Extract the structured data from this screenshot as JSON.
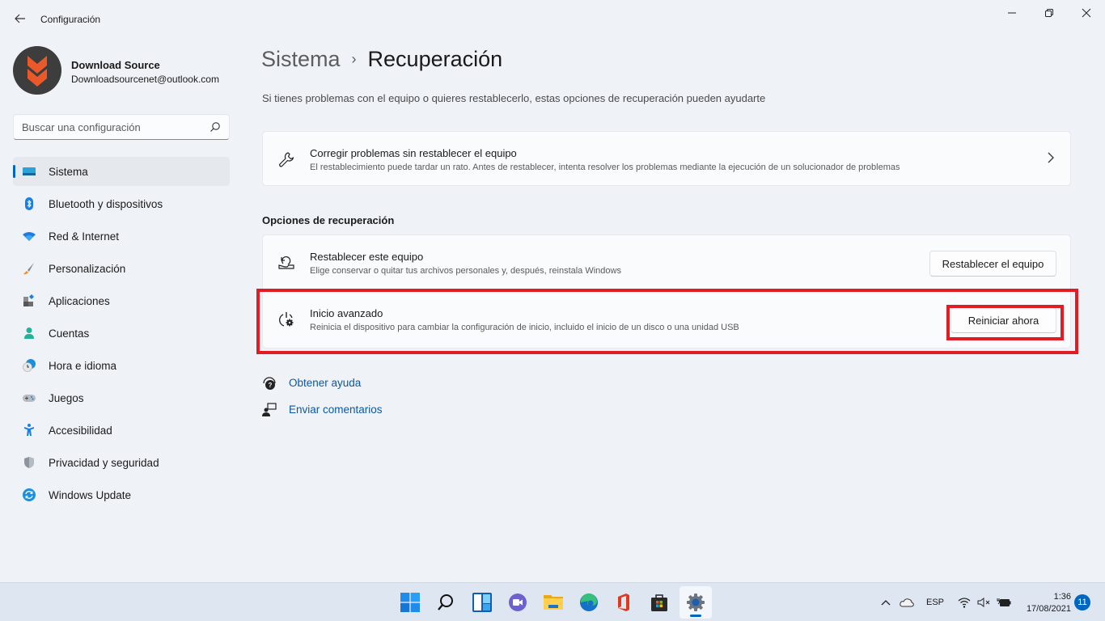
{
  "window": {
    "app_title": "Configuración",
    "back_icon": "arrow-left-icon",
    "controls": [
      "minimize",
      "maximize",
      "close"
    ]
  },
  "profile": {
    "name": "Download Source",
    "email": "Downloadsourcenet@outlook.com"
  },
  "search": {
    "placeholder": "Buscar una configuración",
    "value": ""
  },
  "sidebar": {
    "items": [
      {
        "label": "Sistema",
        "icon": "system-icon",
        "active": true
      },
      {
        "label": "Bluetooth y dispositivos",
        "icon": "bluetooth-icon"
      },
      {
        "label": "Red & Internet",
        "icon": "wifi-icon"
      },
      {
        "label": "Personalización",
        "icon": "brush-icon"
      },
      {
        "label": "Aplicaciones",
        "icon": "apps-icon"
      },
      {
        "label": "Cuentas",
        "icon": "account-icon"
      },
      {
        "label": "Hora e idioma",
        "icon": "time-language-icon"
      },
      {
        "label": "Juegos",
        "icon": "gamepad-icon"
      },
      {
        "label": "Accesibilidad",
        "icon": "accessibility-icon"
      },
      {
        "label": "Privacidad y seguridad",
        "icon": "shield-icon"
      },
      {
        "label": "Windows Update",
        "icon": "windows-update-icon"
      }
    ]
  },
  "main": {
    "breadcrumb": {
      "parent": "Sistema",
      "separator": "›",
      "current": "Recuperación"
    },
    "subtitle": "Si tienes problemas con el equipo o quieres restablecerlo, estas opciones de recuperación pueden ayudarte",
    "fix_card": {
      "title": "Corregir problemas sin restablecer el equipo",
      "description": "El restablecimiento puede tardar un rato. Antes de restablecer, intenta resolver los problemas mediante la ejecución de un solucionador de problemas"
    },
    "section_heading": "Opciones de recuperación",
    "options": [
      {
        "title": "Restablecer este equipo",
        "description": "Elige conservar o quitar tus archivos personales y, después, reinstala Windows",
        "button": "Restablecer el equipo"
      },
      {
        "title": "Inicio avanzado",
        "description": "Reinicia el dispositivo para cambiar la configuración de inicio, incluido el inicio de un disco o una unidad USB",
        "button": "Reiniciar ahora",
        "highlighted": true
      }
    ],
    "links": [
      {
        "label": "Obtener ayuda",
        "icon": "help-icon"
      },
      {
        "label": "Enviar comentarios",
        "icon": "feedback-icon"
      }
    ]
  },
  "colors": {
    "accent": "#0067c0",
    "highlight": "#e21b24",
    "link": "#0b57a3",
    "background": "#eff3f8"
  },
  "taskbar": {
    "apps": [
      "start",
      "search",
      "widgets",
      "teams-chat",
      "file-explorer",
      "edge",
      "office",
      "store",
      "settings"
    ],
    "active_app": "settings",
    "tray": {
      "language": "ESP",
      "time": "1:36",
      "date": "17/08/2021",
      "notifications": "11"
    }
  }
}
